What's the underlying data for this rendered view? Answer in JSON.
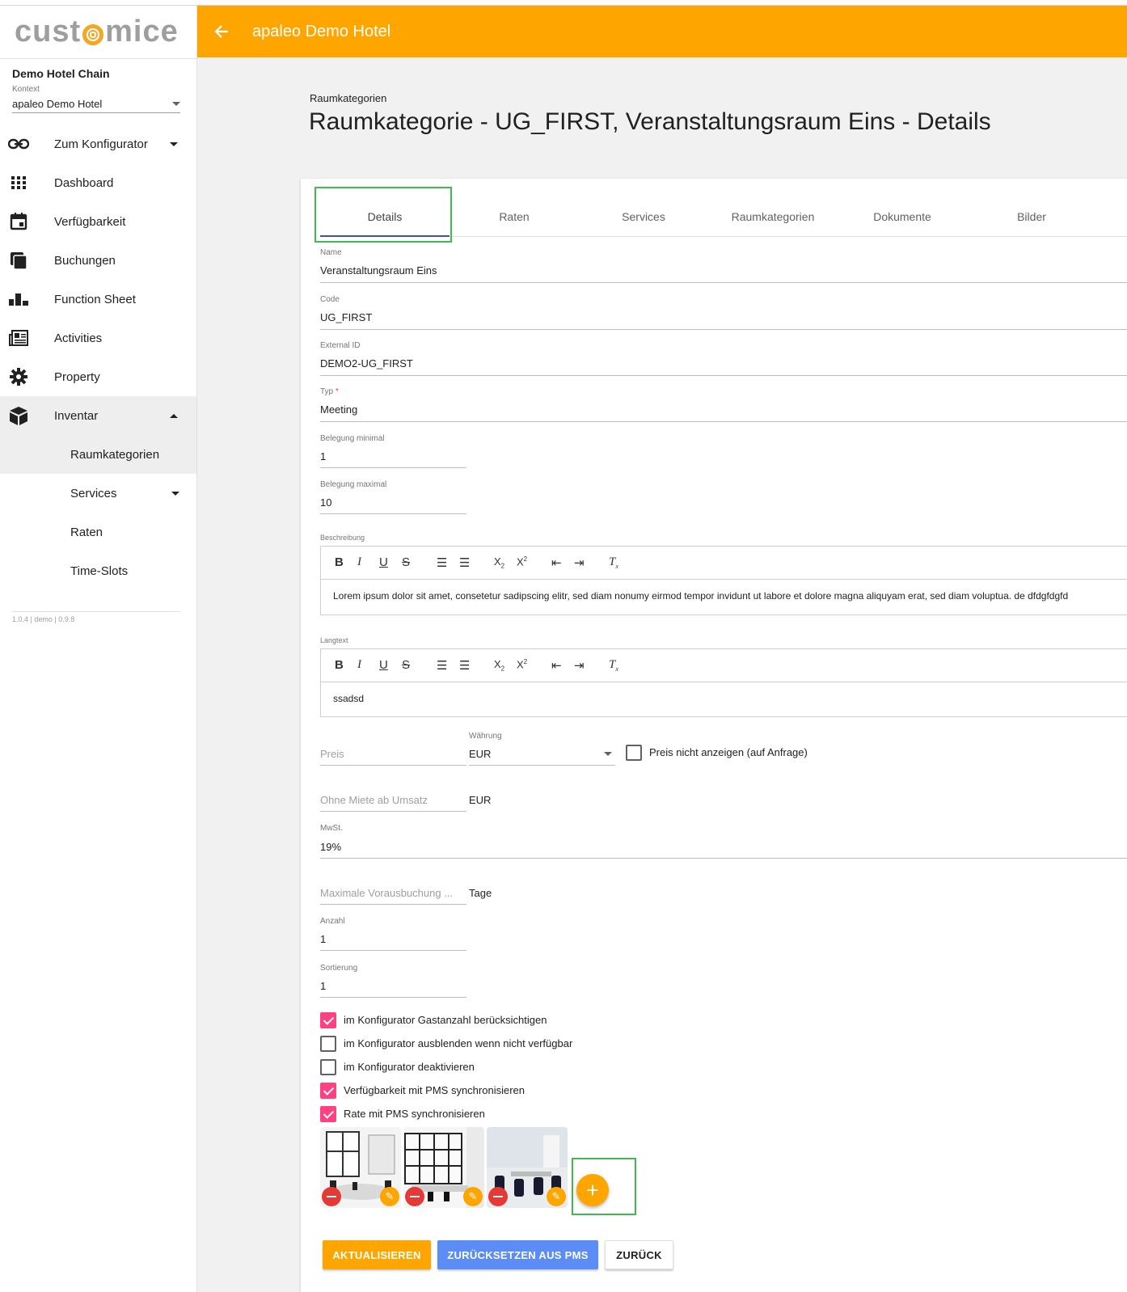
{
  "logo": {
    "text_left": "cust",
    "text_right": "mice"
  },
  "sidebar": {
    "chain": "Demo Hotel Chain",
    "context_label": "Kontext",
    "context_value": "apaleo Demo Hotel",
    "items": [
      {
        "label": "Zum Konfigurator",
        "icon": "link-icon"
      },
      {
        "label": "Dashboard",
        "icon": "apps-grid-icon"
      },
      {
        "label": "Verfügbarkeit",
        "icon": "calendar-icon"
      },
      {
        "label": "Buchungen",
        "icon": "stack-icon"
      },
      {
        "label": "Function Sheet",
        "icon": "bar-chart-icon"
      },
      {
        "label": "Activities",
        "icon": "newspaper-icon"
      },
      {
        "label": "Property",
        "icon": "gear-icon"
      },
      {
        "label": "Inventar",
        "icon": "cube-icon"
      }
    ],
    "subitems": [
      {
        "label": "Raumkategorien"
      },
      {
        "label": "Services"
      },
      {
        "label": "Raten"
      },
      {
        "label": "Time-Slots"
      }
    ],
    "version": "1.0.4 | demo | 0.9.8"
  },
  "header": {
    "title": "apaleo Demo Hotel"
  },
  "page": {
    "breadcrumb": "Raumkategorien",
    "title": "Raumkategorie - UG_FIRST, Veranstaltungsraum Eins - Details"
  },
  "tabs": [
    "Details",
    "Raten",
    "Services",
    "Raumkategorien",
    "Dokumente",
    "Bilder"
  ],
  "form": {
    "name_label": "Name",
    "name_value": "Veranstaltungsraum Eins",
    "code_label": "Code",
    "code_value": "UG_FIRST",
    "external_label": "External ID",
    "external_value": "DEMO2-UG_FIRST",
    "typ_label": "Typ",
    "typ_required": "*",
    "typ_value": "Meeting",
    "min_label": "Belegung minimal",
    "min_value": "1",
    "max_label": "Belegung maximal",
    "max_value": "10",
    "beschreibung_label": "Beschreibung",
    "beschreibung_text": "Lorem ipsum dolor sit amet, consetetur sadipscing elitr, sed diam nonumy eirmod tempor invidunt ut labore et dolore magna aliquyam erat, sed diam voluptua. de dfdgfdgfd",
    "langtext_label": "Langtext",
    "langtext_text": "ssadsd",
    "preis_placeholder": "Preis",
    "waehrung_label": "Währung",
    "waehrung_value": "EUR",
    "preis_anfrage_label": "Preis nicht anzeigen (auf Anfrage)",
    "umsatz_placeholder": "Ohne Miete ab Umsatz",
    "umsatz_unit": "EUR",
    "mwst_label": "MwSt.",
    "mwst_value": "19%",
    "voraus_placeholder": "Maximale Vorausbuchung ...",
    "voraus_unit": "Tage",
    "anzahl_label": "Anzahl",
    "anzahl_value": "1",
    "sortierung_label": "Sortierung",
    "sortierung_value": "1"
  },
  "checkboxes": [
    {
      "label": "im Konfigurator Gastanzahl berücksichtigen",
      "checked": true
    },
    {
      "label": "im Konfigurator ausblenden wenn nicht verfügbar",
      "checked": false
    },
    {
      "label": "im Konfigurator deaktivieren",
      "checked": false
    },
    {
      "label": "Verfügbarkeit mit PMS synchronisieren",
      "checked": true
    },
    {
      "label": "Rate mit PMS synchronisieren",
      "checked": true
    }
  ],
  "buttons": {
    "update": "AKTUALISIEREN",
    "reset": "ZURÜCKSETZEN AUS PMS",
    "back": "ZURÜCK"
  },
  "colors": {
    "accent": "#ffa500",
    "primary": "#5c8cf5",
    "checkbox": "#ff4081",
    "highlight": "#3dbb4f"
  }
}
